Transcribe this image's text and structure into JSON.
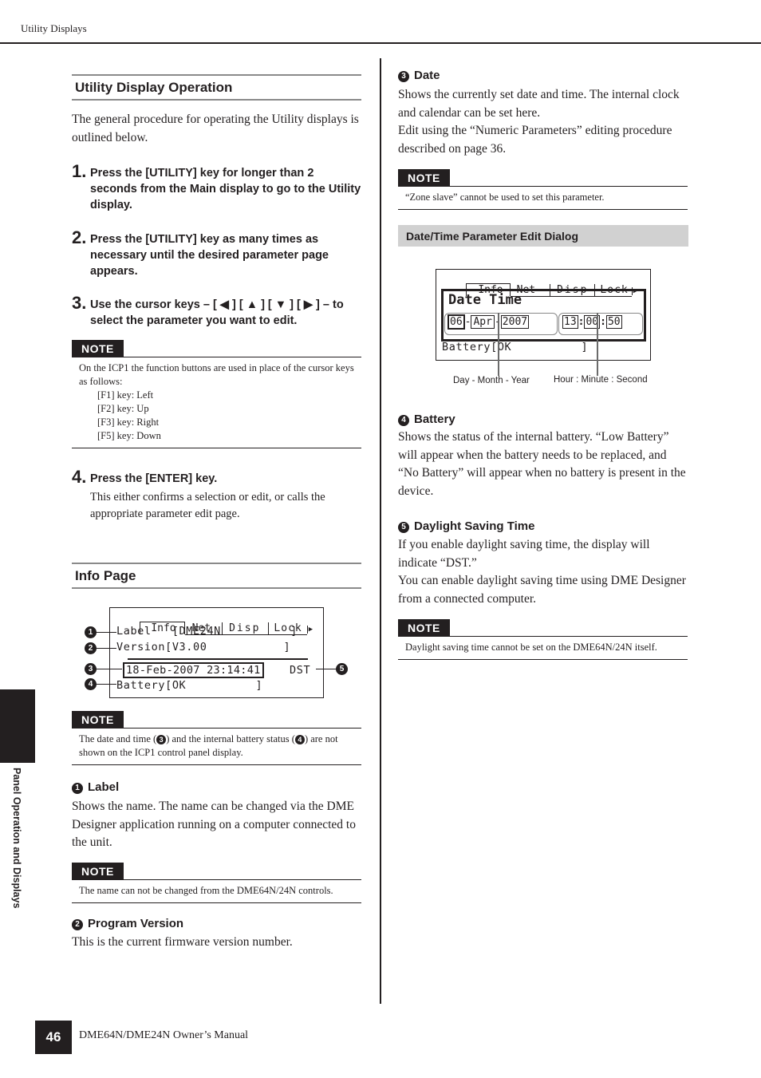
{
  "header": {
    "running_title": "Utility Displays"
  },
  "left_column": {
    "section1": {
      "title": "Utility Display Operation",
      "intro": "The general procedure for operating the Utility displays is outlined below.",
      "steps": [
        {
          "num": "1.",
          "text": "Press the [UTILITY] key for longer than 2 seconds from the Main display to go to the Utility display."
        },
        {
          "num": "2.",
          "text": "Press the [UTILITY] key as many times as necessary until the desired parameter page appears."
        },
        {
          "num": "3.",
          "text": "Use the cursor keys – [ ◀ ] [ ▲ ] [ ▼ ] [ ▶ ] – to select the parameter you want to edit."
        },
        {
          "num": "4.",
          "text": "Press the [ENTER] key.",
          "detail": "This either confirms a selection or edit, or calls the appropriate parameter edit page."
        }
      ],
      "note": {
        "label": "NOTE",
        "text": "On the ICP1 the function buttons are used in place of the cursor keys as follows:",
        "items": [
          "[F1] key: Left",
          "[F2] key: Up",
          "[F3] key: Right",
          "[F5] key: Down"
        ]
      }
    },
    "section2": {
      "title": "Info Page",
      "lcd": {
        "tabs": [
          "Info",
          "Net",
          "Disp",
          "Lock"
        ],
        "label_row": "Label   [DME24N          ]",
        "version_row": "Version[V3.00           ]",
        "datetime": "18-Feb-2007 23:14:41",
        "dst": "DST",
        "battery_row": "Battery[OK          ]",
        "callouts": [
          "1",
          "2",
          "3",
          "4",
          "5"
        ]
      },
      "note": {
        "label": "NOTE",
        "text_a": "The date and time (",
        "ref_a": "3",
        "text_b": ") and the internal battery status (",
        "ref_b": "4",
        "text_c": ") are not shown on the ICP1 control panel display."
      },
      "label_item": {
        "num": "1",
        "title": "Label",
        "text": "Shows the name. The name can be changed via the DME Designer application running on a computer connected to the unit."
      },
      "label_note": {
        "label": "NOTE",
        "text": "The name can not be changed from the DME64N/24N controls."
      },
      "version_item": {
        "num": "2",
        "title": "Program Version",
        "text": "This is the current firmware version number."
      }
    }
  },
  "right_column": {
    "date_item": {
      "num": "3",
      "title": "Date",
      "text1": "Shows the currently set date and time. The internal clock and calendar can be set here.",
      "text2": "Edit using the “Numeric Parameters” editing procedure described on page 36."
    },
    "date_note": {
      "label": "NOTE",
      "text": "“Zone slave” cannot be used to set this parameter."
    },
    "dialog_section": {
      "title": "Date/Time Parameter Edit Dialog",
      "lcd": {
        "tabs": [
          "Info",
          "Net",
          "Disp",
          "Lock"
        ],
        "heading": "Date Time",
        "day": "06",
        "month": "Apr",
        "year": "2007",
        "hour": "13",
        "minute": "00",
        "second": "50",
        "battery_row": "Battery[OK          ]"
      },
      "caption_date": "Day -  Month - Year",
      "caption_time": "Hour : Minute : Second"
    },
    "battery_item": {
      "num": "4",
      "title": "Battery",
      "text": "Shows the status of the internal battery. “Low Battery” will appear when the battery needs to be replaced, and “No Battery” will appear when no battery is present in the device."
    },
    "dst_item": {
      "num": "5",
      "title": "Daylight Saving Time",
      "text1": "If you enable daylight saving time, the display will indicate “DST.”",
      "text2": "You can enable daylight saving time using DME Designer from a connected computer."
    },
    "dst_note": {
      "label": "NOTE",
      "text": "Daylight saving time cannot be set on the DME64N/24N itself."
    }
  },
  "side_tab": {
    "label": "Panel Operation and Displays"
  },
  "footer": {
    "page_number": "46",
    "manual_title": "DME64N/DME24N Owner’s Manual"
  }
}
